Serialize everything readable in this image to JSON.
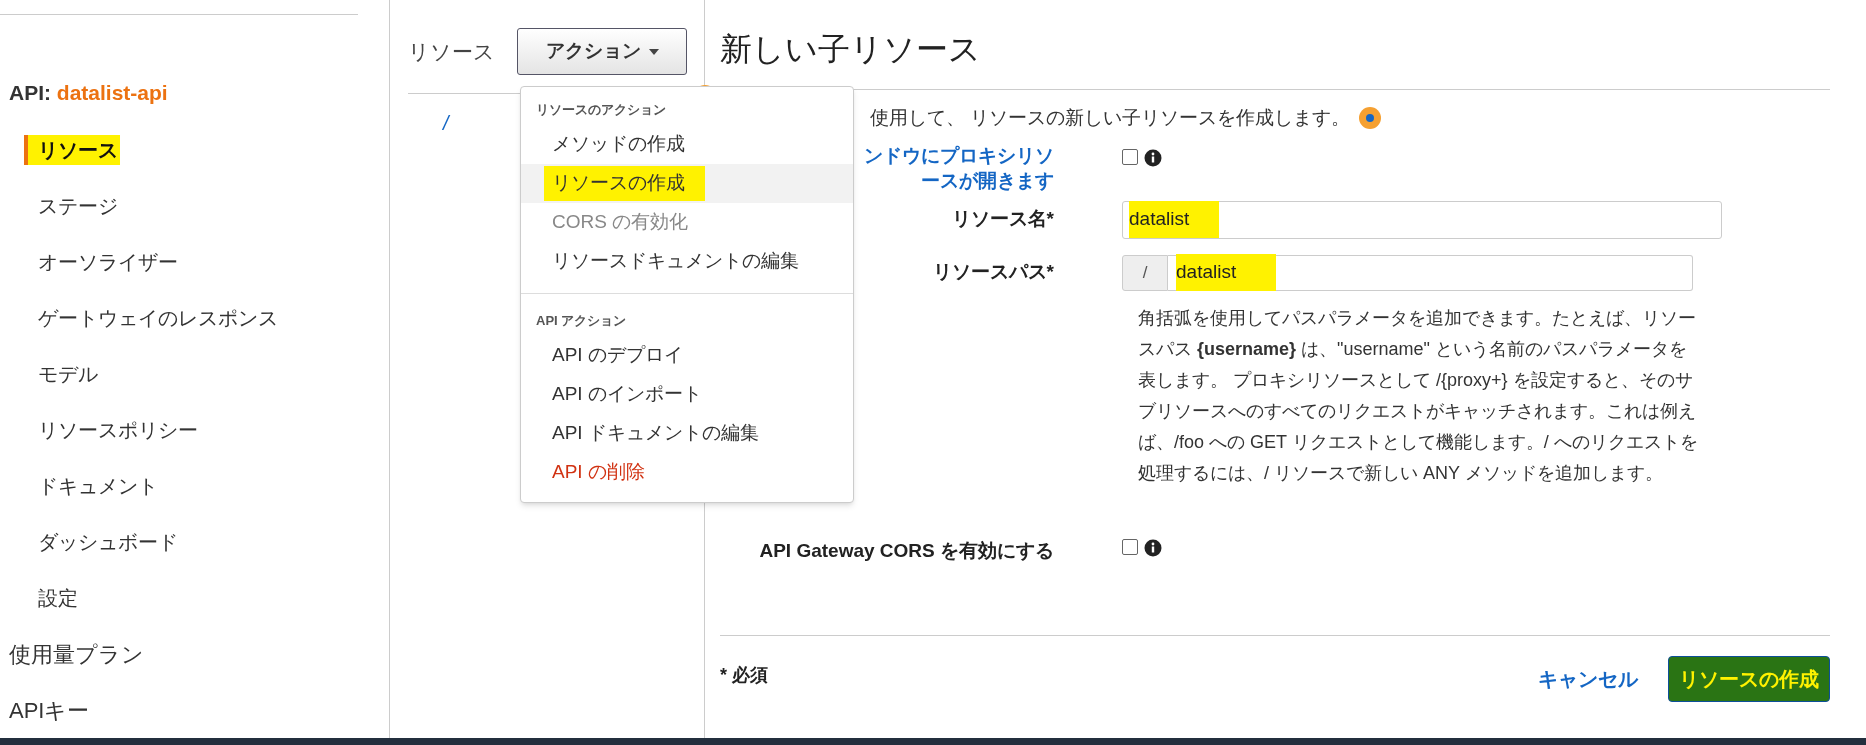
{
  "sidebar": {
    "api_label": "API:",
    "api_name": "datalist-api",
    "items": [
      {
        "label": "リソース",
        "selected": true,
        "highlighted": true
      },
      {
        "label": "ステージ",
        "selected": false,
        "highlighted": false
      },
      {
        "label": "オーソライザー",
        "selected": false,
        "highlighted": false
      },
      {
        "label": "ゲートウェイのレスポンス",
        "selected": false,
        "highlighted": false
      },
      {
        "label": "モデル",
        "selected": false,
        "highlighted": false
      },
      {
        "label": "リソースポリシー",
        "selected": false,
        "highlighted": false
      },
      {
        "label": "ドキュメント",
        "selected": false,
        "highlighted": false
      },
      {
        "label": "ダッシュボード",
        "selected": false,
        "highlighted": false
      },
      {
        "label": "設定",
        "selected": false,
        "highlighted": false
      }
    ],
    "sections": [
      "使用量プラン",
      "APIキー"
    ]
  },
  "resources_panel": {
    "title": "リソース",
    "actions_button": "アクション",
    "tree": [
      "/"
    ]
  },
  "actions_menu": {
    "groups": [
      {
        "header": "リソースのアクション",
        "items": [
          {
            "label": "メソッドの作成",
            "kind": "normal",
            "selected": false,
            "highlighted": false
          },
          {
            "label": "リソースの作成",
            "kind": "normal",
            "selected": true,
            "highlighted": true
          },
          {
            "label": "CORS の有効化",
            "kind": "disabled",
            "selected": false,
            "highlighted": false
          },
          {
            "label": "リソースドキュメントの編集",
            "kind": "normal",
            "selected": false,
            "highlighted": false
          }
        ]
      },
      {
        "header": "API アクション",
        "items": [
          {
            "label": "API のデプロイ",
            "kind": "normal",
            "selected": false,
            "highlighted": false
          },
          {
            "label": "API のインポート",
            "kind": "normal",
            "selected": false,
            "highlighted": false
          },
          {
            "label": "API ドキュメントの編集",
            "kind": "normal",
            "selected": false,
            "highlighted": false
          },
          {
            "label": "API の削除",
            "kind": "danger",
            "selected": false,
            "highlighted": false
          }
        ]
      }
    ]
  },
  "form": {
    "title": "新しい子リソース",
    "description": "使用して、 リソースの新しい子リソースを作成します。",
    "proxy": {
      "label_lines": [
        "ンドウにプロキシリソ",
        "ースが開きます"
      ],
      "checked": false
    },
    "resource_name": {
      "label": "リソース名*",
      "value": "datalist",
      "highlighted": true
    },
    "resource_path": {
      "label": "リソースパス*",
      "prefix": "/",
      "value": "datalist",
      "highlighted": true
    },
    "help": "角括弧を使用してパスパラメータを追加できます。たとえば、リソースパス **{username}** は、\"username\" という名前のパスパラメータを表します。 プロキシリソースとして /{proxy+} を設定すると、そのサブリソースへのすべてのリクエストがキャッチされます。これは例えば、/foo への GET リクエストとして機能します。/ へのリクエストを処理するには、/ リソースで新しい ANY メソッドを追加します。",
    "cors": {
      "label": "API Gateway CORS を有効にする",
      "checked": false
    },
    "required_note": "* 必須",
    "cancel": "キャンセル",
    "submit": {
      "label": "リソースの作成",
      "highlighted": true
    }
  }
}
